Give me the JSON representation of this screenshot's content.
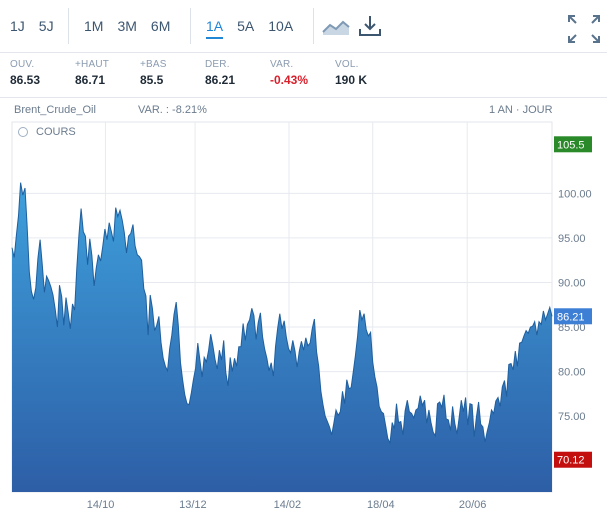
{
  "toolbar": {
    "periods_short": [
      "1J",
      "5J"
    ],
    "periods_mid": [
      "1M",
      "3M",
      "6M"
    ],
    "periods_long": [
      "1A",
      "5A",
      "10A"
    ],
    "active_period": "1A",
    "icons": [
      "line-chart-icon",
      "download-icon",
      "fullscreen-icon"
    ]
  },
  "stats": [
    {
      "label": "OUV.",
      "value": "86.53",
      "negative": false
    },
    {
      "label": "+HAUT",
      "value": "86.71",
      "negative": false
    },
    {
      "label": "+BAS",
      "value": "85.5",
      "negative": false
    },
    {
      "label": "DER.",
      "value": "86.21",
      "negative": false
    },
    {
      "label": "VAR.",
      "value": "-0.43%",
      "negative": true
    },
    {
      "label": "VOL.",
      "value": "190 K",
      "negative": false
    }
  ],
  "chart_header": {
    "name": "Brent_Crude_Oil",
    "variation": "VAR. : -8.21%",
    "period": "1 AN · JOUR",
    "series_label": "COURS"
  },
  "colors": {
    "accent": "#1f87d6",
    "area_top": "#3ea0dc",
    "area_bottom": "#2d5ea6",
    "max_badge": "#2a8a2a",
    "min_badge": "#c40f0f",
    "last_badge": "#3e7fd6"
  },
  "chart_data": {
    "type": "area",
    "title": "Brent_Crude_Oil",
    "x_ticks": [
      "14/10",
      "13/12",
      "14/02",
      "18/04",
      "20/06"
    ],
    "y_ticks": [
      "100.00",
      "95.00",
      "90.00",
      "85.00",
      "80.00",
      "75.00"
    ],
    "ylim": [
      66.5,
      108
    ],
    "grid": true,
    "markers": {
      "max": "105.5",
      "last": "86.21",
      "min": "70.12"
    },
    "series": [
      {
        "values": [
          93.9,
          92.8,
          95.2,
          97.5,
          101.2,
          99.8,
          100.6,
          96.4,
          91.2,
          89.0,
          88.1,
          89.4,
          92.7,
          94.8,
          92.1,
          88.9,
          90.7,
          90.2,
          89.5,
          88.6,
          87.0,
          85.0,
          89.7,
          88.4,
          85.2,
          88.3,
          86.6,
          84.8,
          87.6,
          86.9,
          91.6,
          95.4,
          98.3,
          95.7,
          95.2,
          92.0,
          94.9,
          93.0,
          89.6,
          91.6,
          93.1,
          92.4,
          94.0,
          96.0,
          94.8,
          96.7,
          95.7,
          94.6,
          98.4,
          97.4,
          98.1,
          97.0,
          95.6,
          93.3,
          95.2,
          95.5,
          96.5,
          94.1,
          93.1,
          92.9,
          92.5,
          89.3,
          88.5,
          84.1,
          88.6,
          87.1,
          84.6,
          85.2,
          86.2,
          83.3,
          81.5,
          80.6,
          80.1,
          82.6,
          84.1,
          86.4,
          87.8,
          85.2,
          81.0,
          79.1,
          77.4,
          76.4,
          76.3,
          77.6,
          79.1,
          80.4,
          83.2,
          81.3,
          79.4,
          81.6,
          81.1,
          82.4,
          84.2,
          82.9,
          81.4,
          80.3,
          82.4,
          81.3,
          83.5,
          79.9,
          78.4,
          81.6,
          80.0,
          81.5,
          80.6,
          82.8,
          82.8,
          85.4,
          83.5,
          85.3,
          85.8,
          87.1,
          86.3,
          83.6,
          85.5,
          86.6,
          83.9,
          82.5,
          81.5,
          80.1,
          81.0,
          79.5,
          82.8,
          84.9,
          86.5,
          84.8,
          85.7,
          83.9,
          82.6,
          82.1,
          83.5,
          82.3,
          80.5,
          82.3,
          83.4,
          82.4,
          83.8,
          82.9,
          83.2,
          84.8,
          85.9,
          82.2,
          80.6,
          77.8,
          76.3,
          75.0,
          74.4,
          73.8,
          72.9,
          74.2,
          75.7,
          75.1,
          75.5,
          77.8,
          76.4,
          79.1,
          78.1,
          78.2,
          80.0,
          81.8,
          84.0,
          86.9,
          85.8,
          86.5,
          84.7,
          84.0,
          84.4,
          81.1,
          79.4,
          78.3,
          76.1,
          75.5,
          75.3,
          73.9,
          72.5,
          72.0,
          74.3,
          73.6,
          76.4,
          74.3,
          74.4,
          72.9,
          75.6,
          76.8,
          75.5,
          75.3,
          74.8,
          75.7,
          75.9,
          77.3,
          76.2,
          76.8,
          74.2,
          75.7,
          74.3,
          73.2,
          72.8,
          76.4,
          76.6,
          76.0,
          77.4,
          74.7,
          74.6,
          73.4,
          76.1,
          74.2,
          73.0,
          74.8,
          76.8,
          75.5,
          77.1,
          74.0,
          76.4,
          76.3,
          72.7,
          74.9,
          76.6,
          74.1,
          73.8,
          72.1,
          73.3,
          74.3,
          75.7,
          75.3,
          76.7,
          77.1,
          76.1,
          78.3,
          79.0,
          77.2,
          80.8,
          80.9,
          80.2,
          82.3,
          80.6,
          83.2,
          83.3,
          84.0,
          84.6,
          84.3,
          85.0,
          85.1,
          85.6,
          84.1,
          85.6,
          85.3,
          86.8,
          85.8,
          86.5,
          87.2,
          86.2
        ]
      }
    ]
  }
}
